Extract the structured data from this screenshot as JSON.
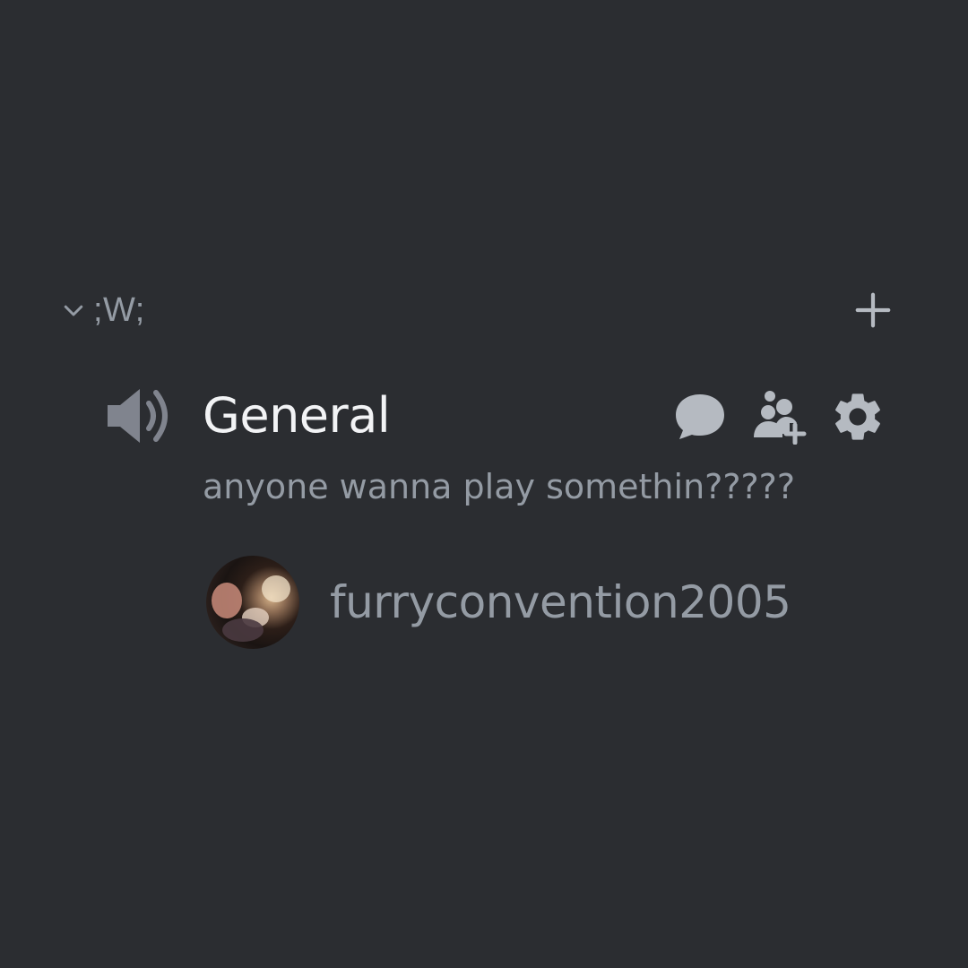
{
  "category": {
    "name": ";W;",
    "chevron_icon": "chevron-down-icon",
    "add_icon": "plus-icon"
  },
  "channel": {
    "name": "General",
    "type_icon": "speaker-icon",
    "status": "anyone wanna play somethin?????",
    "actions": [
      {
        "icon": "chat-bubble-icon"
      },
      {
        "icon": "invite-users-icon"
      },
      {
        "icon": "gear-icon"
      }
    ]
  },
  "voice_users": [
    {
      "username": "furryconvention2005"
    }
  ],
  "colors": {
    "background": "#2b2d31",
    "muted_text": "#949ba4",
    "channel_text": "#f2f3f5",
    "icon": "#b5bac1"
  }
}
